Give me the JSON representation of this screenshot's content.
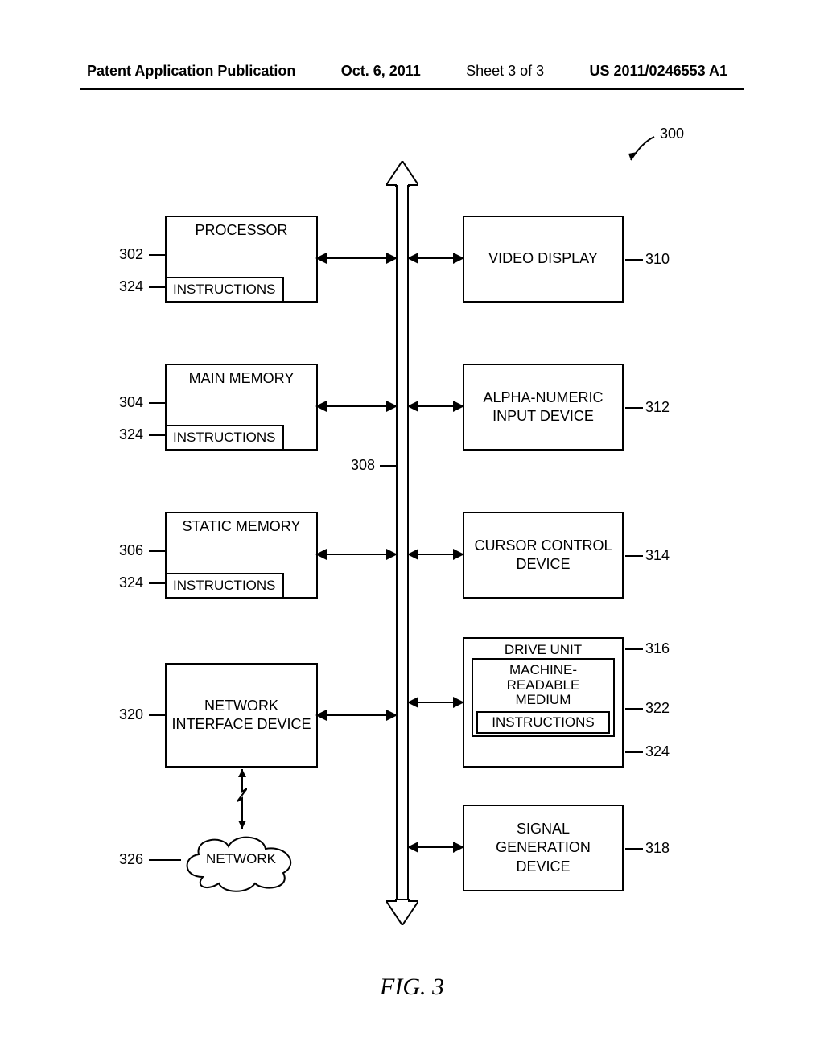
{
  "header": {
    "publication": "Patent Application Publication",
    "date": "Oct. 6, 2011",
    "sheet": "Sheet 3 of 3",
    "docnum": "US 2011/0246553 A1"
  },
  "figure_label": "FIG. 3",
  "refs": {
    "r300": "300",
    "r302": "302",
    "r304": "304",
    "r306": "306",
    "r308": "308",
    "r310": "310",
    "r312": "312",
    "r314": "314",
    "r316": "316",
    "r318": "318",
    "r320": "320",
    "r322": "322",
    "r324": "324",
    "r326": "326"
  },
  "blocks": {
    "processor": "PROCESSOR",
    "instructions": "INSTRUCTIONS",
    "main_memory": "MAIN MEMORY",
    "static_memory": "STATIC MEMORY",
    "network_interface": "NETWORK INTERFACE DEVICE",
    "network": "NETWORK",
    "video_display": "VIDEO DISPLAY",
    "alpha_numeric": "ALPHA-NUMERIC INPUT DEVICE",
    "cursor_control": "CURSOR CONTROL DEVICE",
    "drive_unit": "DRIVE UNIT",
    "machine_readable_medium": "MACHINE-\nREADABLE\nMEDIUM",
    "signal_generation": "SIGNAL GENERATION DEVICE"
  }
}
